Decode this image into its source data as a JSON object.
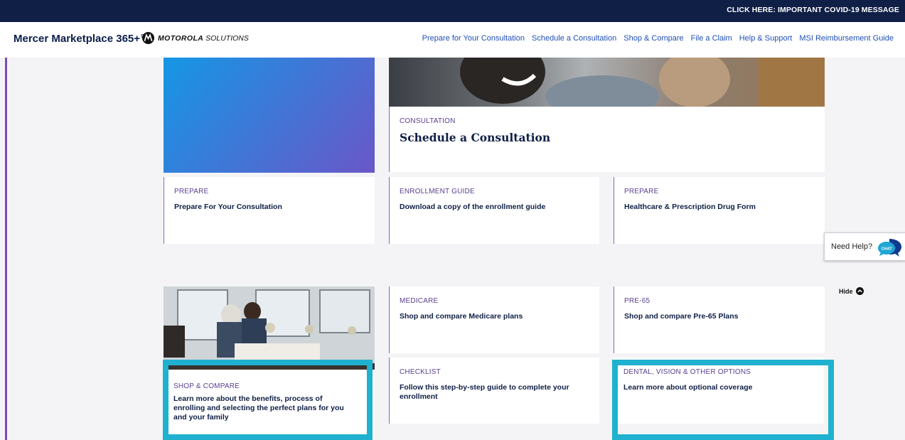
{
  "top_banner": {
    "covid_link": "CLICK HERE:  IMPORTANT COVID-19 MESSAGE"
  },
  "header": {
    "brand_main": "Mercer Marketplace 365+",
    "brand_mark": "SM",
    "partner_bold": "MOTOROLA",
    "partner_rest": " SOLUTIONS",
    "nav": [
      "Prepare for Your Consultation",
      "Schedule a Consultation",
      "Shop & Compare",
      "File a Claim",
      "Help & Support",
      "MSI Reimbursement Guide"
    ]
  },
  "consultation_card": {
    "eyebrow": "CONSULTATION",
    "title": "Schedule a Consultation"
  },
  "row1": [
    {
      "eyebrow": "PREPARE",
      "title": "Prepare For Your Consultation"
    },
    {
      "eyebrow": "ENROLLMENT GUIDE",
      "title": "Download a copy of the enrollment guide"
    },
    {
      "eyebrow": "PREPARE",
      "title": "Healthcare & Prescription Drug Form"
    }
  ],
  "row2": [
    {
      "eyebrow": "MEDICARE",
      "title": "Shop and compare Medicare plans"
    },
    {
      "eyebrow": "PRE-65",
      "title": "Shop and compare Pre-65 Plans"
    }
  ],
  "row3": [
    {
      "eyebrow": "SHOP & COMPARE",
      "title": "Learn more about the benefits, process of enrolling and selecting the perfect plans for you and your family"
    },
    {
      "eyebrow": "CHECKLIST",
      "title": "Follow this step-by-step guide to complete your enrollment"
    },
    {
      "eyebrow": "DENTAL, VISION & OTHER OPTIONS",
      "title": "Learn more about optional coverage"
    }
  ],
  "help_widget": {
    "label": "Need Help?",
    "chat_text": "CHAT"
  },
  "hide_toggle": {
    "label": "Hide"
  },
  "colors": {
    "highlight": "#1fb1cf",
    "navy": "#0f1f45",
    "accent_purple": "#7b4bb7",
    "link_blue": "#1f4fb7"
  }
}
